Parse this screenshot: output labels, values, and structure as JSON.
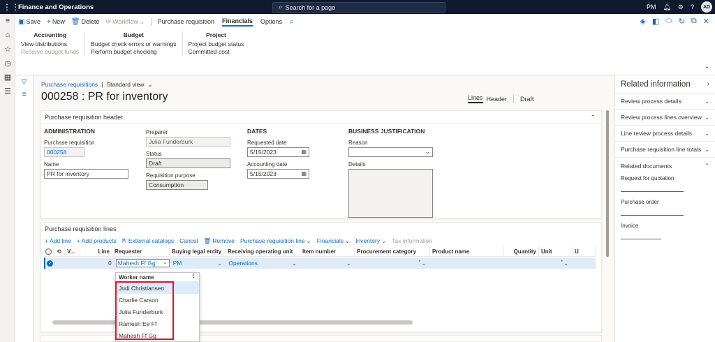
{
  "app": {
    "name": "Finance and Operations",
    "search_placeholder": "Search for a page",
    "company": "PM",
    "user_initials": "AD"
  },
  "actionpane": {
    "buttons": {
      "save": "Save",
      "new": "New",
      "delete": "Delete",
      "workflow": "Workflow"
    },
    "tabs": [
      "Purchase requisition",
      "Financials",
      "Options"
    ],
    "groups": [
      {
        "title": "Accounting",
        "items": [
          "View distributions",
          "Reserve budget funds"
        ]
      },
      {
        "title": "Budget",
        "items": [
          "Budget check errors or warnings",
          "Perform budget checking"
        ]
      },
      {
        "title": "Project",
        "items": [
          "Project budget status",
          "Committed cost"
        ]
      }
    ]
  },
  "page": {
    "breadcrumb": "Purchase requisitions",
    "view": "Standard view",
    "title": "000258 : PR for inventory",
    "view_tabs": {
      "lines": "Lines",
      "header": "Header",
      "status": "Draft"
    }
  },
  "header_section": {
    "title": "Purchase requisition header",
    "administration": {
      "title": "ADMINISTRATION",
      "pr_label": "Purchase requisition",
      "pr_value": "000258",
      "name_label": "Name",
      "name_value": "PR for inventory"
    },
    "preparer": {
      "label": "Preparer",
      "value": "Julia Funderburk",
      "status_label": "Status",
      "status_value": "Draft",
      "purpose_label": "Requisition purpose",
      "purpose_value": "Consumption"
    },
    "dates": {
      "title": "DATES",
      "requested_label": "Requested date",
      "requested_value": "5/15/2023",
      "accounting_label": "Accounting date",
      "accounting_value": "5/15/2023"
    },
    "justification": {
      "title": "BUSINESS JUSTIFICATION",
      "reason_label": "Reason",
      "reason_value": "",
      "details_label": "Details"
    }
  },
  "lines_section": {
    "title": "Purchase requisition lines",
    "toolbar": {
      "add_line": "Add line",
      "add_products": "Add products",
      "external_catalogs": "External catalogs",
      "cancel": "Cancel",
      "remove": "Remove",
      "pr_line": "Purchase requisition line",
      "financials": "Financials",
      "inventory": "Inventory",
      "tax_info": "Tax information"
    },
    "columns": {
      "v": "V...",
      "line": "Line",
      "requester": "Requester",
      "buying_entity": "Buying legal entity",
      "operating_unit": "Receiving operating unit",
      "item_number": "Item number",
      "procurement_category": "Procurement category",
      "product_name": "Product name",
      "quantity": "Quantity",
      "unit": "Unit",
      "u": "U"
    },
    "row": {
      "line": "0",
      "requester": "Mahesh Ff Gg",
      "buying_entity": "PM",
      "operating_unit": "Operations",
      "item_number": "",
      "procurement_category": "",
      "product_name": "",
      "quantity": "",
      "unit": ""
    }
  },
  "lookup": {
    "header": "Worker name",
    "items": [
      "Jodi Christiansen",
      "Charlie Carson",
      "Julia Funderburk",
      "Ramesh Ee Ff",
      "Mahesh Ff Gg"
    ]
  },
  "right_pane": {
    "title": "Related information",
    "sections": [
      "Review process details",
      "Review process lines overview",
      "Line review process details",
      "Purchase requisition line totals",
      "Related documents"
    ],
    "related_docs": [
      "Request for quotation",
      "Purchase order",
      "Invoice"
    ]
  },
  "colors": {
    "accent": "#0f6cbd",
    "topbar": "#101a2e",
    "highlight": "#e81123"
  }
}
